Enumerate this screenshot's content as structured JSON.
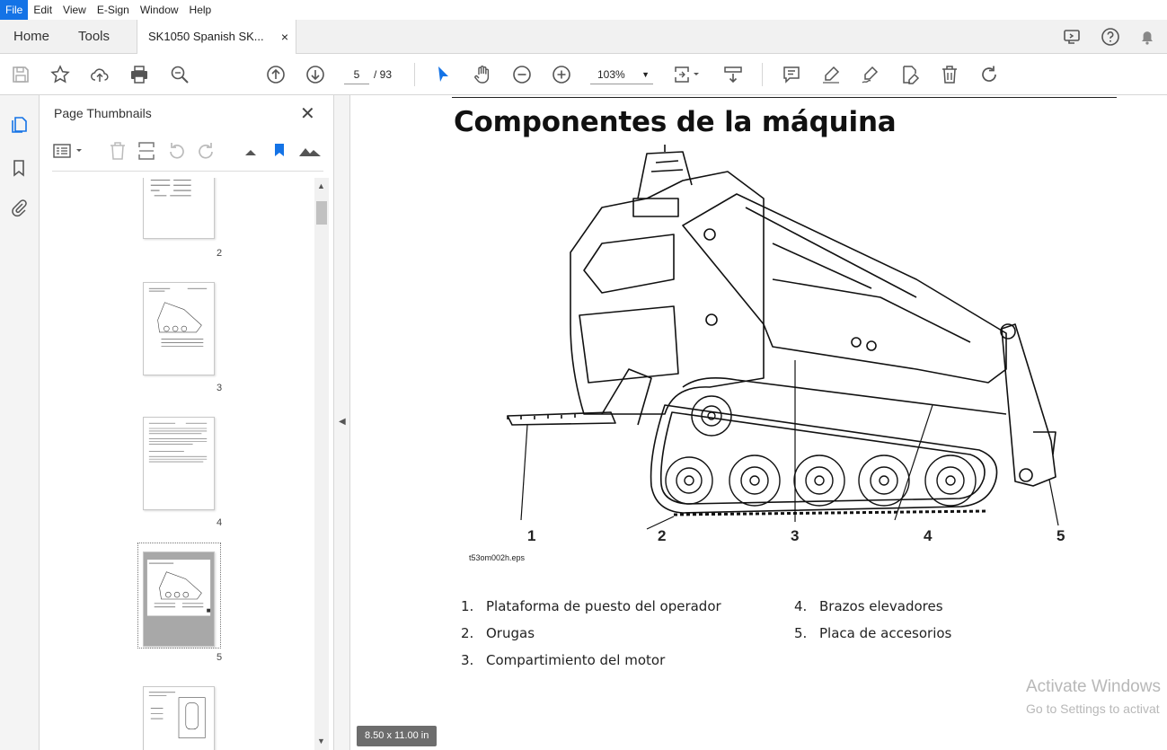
{
  "menu": {
    "items": [
      "File",
      "Edit",
      "View",
      "E-Sign",
      "Window",
      "Help"
    ]
  },
  "tabs": {
    "home": "Home",
    "tools": "Tools",
    "document": "SK1050 Spanish SK...",
    "close": "×"
  },
  "toolbar": {
    "current_page": "5",
    "total_pages": "/ 93",
    "zoom": "103%"
  },
  "panel": {
    "title": "Page Thumbnails",
    "close": "✕",
    "pages": [
      "2",
      "3",
      "4",
      "5"
    ]
  },
  "document": {
    "title": "Componentes de la máquina",
    "figure_file": "t53om002h.eps",
    "callouts": [
      "1",
      "2",
      "3",
      "4",
      "5"
    ],
    "legend": [
      {
        "num": "1.",
        "text": "Plataforma de puesto del operador"
      },
      {
        "num": "2.",
        "text": "Orugas"
      },
      {
        "num": "3.",
        "text": "Compartimiento del motor"
      },
      {
        "num": "4.",
        "text": "Brazos elevadores"
      },
      {
        "num": "5.",
        "text": "Placa de accesorios"
      }
    ]
  },
  "status": {
    "page_size": "8.50 x 11.00 in"
  },
  "watermark": {
    "line1": "Activate Windows",
    "line2": "Go to Settings to activat"
  },
  "colors": {
    "accent": "#1473e6"
  }
}
